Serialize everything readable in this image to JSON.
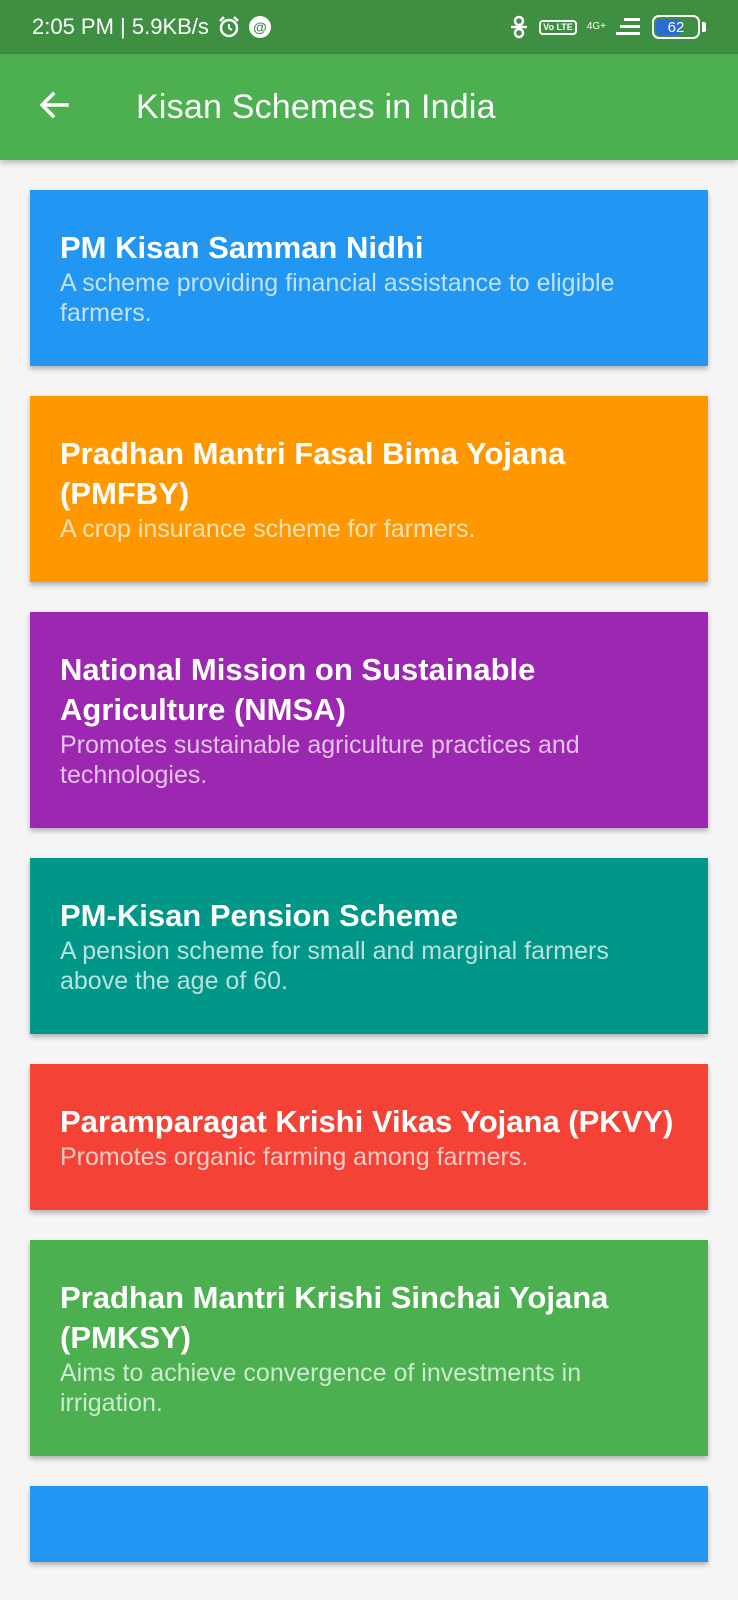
{
  "status_bar": {
    "time_speed": "2:05 PM | 5.9KB/s",
    "network": "4G+",
    "volte": "Vo LTE",
    "battery": "62",
    "battery_level": 0.62
  },
  "app_bar": {
    "title": "Kisan Schemes in India",
    "back_icon": "arrow-back-icon"
  },
  "schemes": [
    {
      "title": "PM Kisan Samman Nidhi",
      "description": "A scheme providing financial assistance to eligible farmers.",
      "color": "#2196f3"
    },
    {
      "title": "Pradhan Mantri Fasal Bima Yojana (PMFBY)",
      "description": "A crop insurance scheme for farmers.",
      "color": "#ff9800"
    },
    {
      "title": "National Mission on Sustainable Agriculture (NMSA)",
      "description": "Promotes sustainable agriculture practices and technologies.",
      "color": "#9c27b0"
    },
    {
      "title": "PM-Kisan Pension Scheme",
      "description": "A pension scheme for small and marginal farmers above the age of 60.",
      "color": "#009688"
    },
    {
      "title": "Paramparagat Krishi Vikas Yojana (PKVY)",
      "description": "Promotes organic farming among farmers.",
      "color": "#f44336"
    },
    {
      "title": "Pradhan Mantri Krishi Sinchai Yojana (PMKSY)",
      "description": "Aims to achieve convergence of investments in irrigation.",
      "color": "#4caf50"
    },
    {
      "title": "",
      "description": "",
      "color": "#2196f3"
    }
  ]
}
